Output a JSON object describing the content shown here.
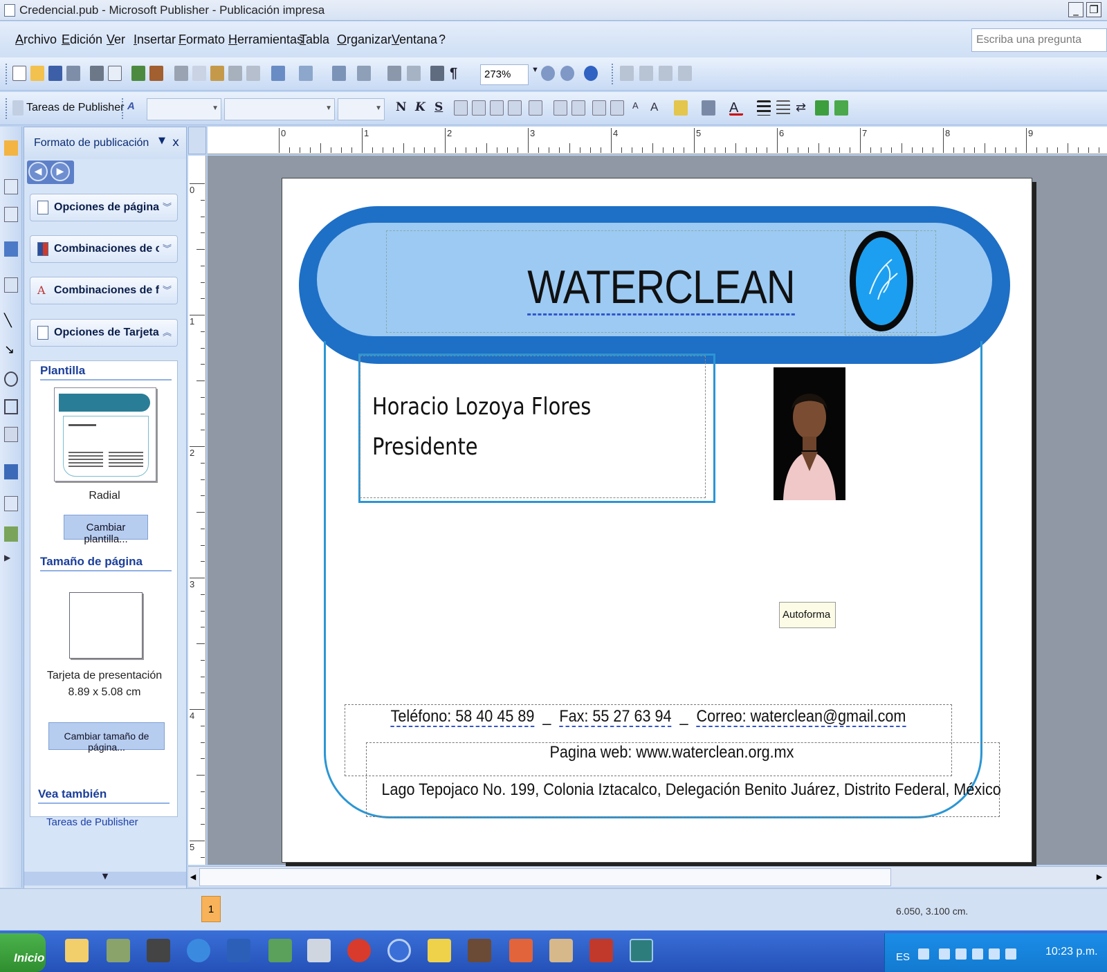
{
  "window": {
    "title": "Credencial.pub - Microsoft Publisher - Publicación impresa",
    "controls": [
      "_",
      "❐"
    ]
  },
  "menu": {
    "items": [
      "Archivo",
      "Edición",
      "Ver",
      "Insertar",
      "Formato",
      "Herramientas",
      "Tabla",
      "Organizar",
      "Ventana",
      "?"
    ],
    "ask_placeholder": "Escriba una pregunta"
  },
  "standard_toolbar": {
    "zoom": "273%"
  },
  "format_toolbar": {
    "tasks_label": "Tareas de Publisher",
    "bold": "N",
    "italic": "K",
    "underline": "S"
  },
  "task_pane": {
    "title": "Formato de publicación",
    "sections": [
      "Opciones de página",
      "Combinaciones de co...",
      "Combinaciones de fu...",
      "Opciones de Tarjeta ..."
    ],
    "template_heading": "Plantilla",
    "template_name": "Radial",
    "change_template": "Cambiar plantilla...",
    "page_size_heading": "Tamaño de página",
    "page_size_name": "Tarjeta de presentación",
    "page_size_dims": "8.89 x 5.08 cm",
    "change_size": "Cambiar tamaño de página...",
    "see_also_heading": "Vea también",
    "see_also_link": "Tareas de Publisher"
  },
  "ruler": {
    "h_labels": [
      "0",
      "1",
      "2",
      "3",
      "4",
      "5",
      "6",
      "7",
      "8",
      "9"
    ],
    "v_labels": [
      "0",
      "1",
      "2",
      "3",
      "4",
      "5"
    ]
  },
  "card": {
    "company": "WATERCLEAN",
    "person_name": "Horacio Lozoya Flores",
    "person_role": "Presidente",
    "tooltip": "Autoforma",
    "phone": "Teléfono: 58 40 45 89",
    "fax": "Fax: 55 27 63 94",
    "email": "Correo: waterclean@gmail.com",
    "web": "Pagina web: www.waterclean.org.mx",
    "address": "Lago Tepojaco No. 199, Colonia Iztacalco, Delegación Benito Juárez, Distrito Federal, México"
  },
  "status": {
    "page_number": "1",
    "coordinates": "6.050, 3.100 cm."
  },
  "taskbar": {
    "start": "Inicio",
    "language": "ES",
    "clock": "10:23 p.m."
  },
  "colors": {
    "header_dark": "#1e6fc6",
    "header_light": "#9ccaf3",
    "outline": "#2b96d4",
    "logo": "#1c9ff0"
  }
}
